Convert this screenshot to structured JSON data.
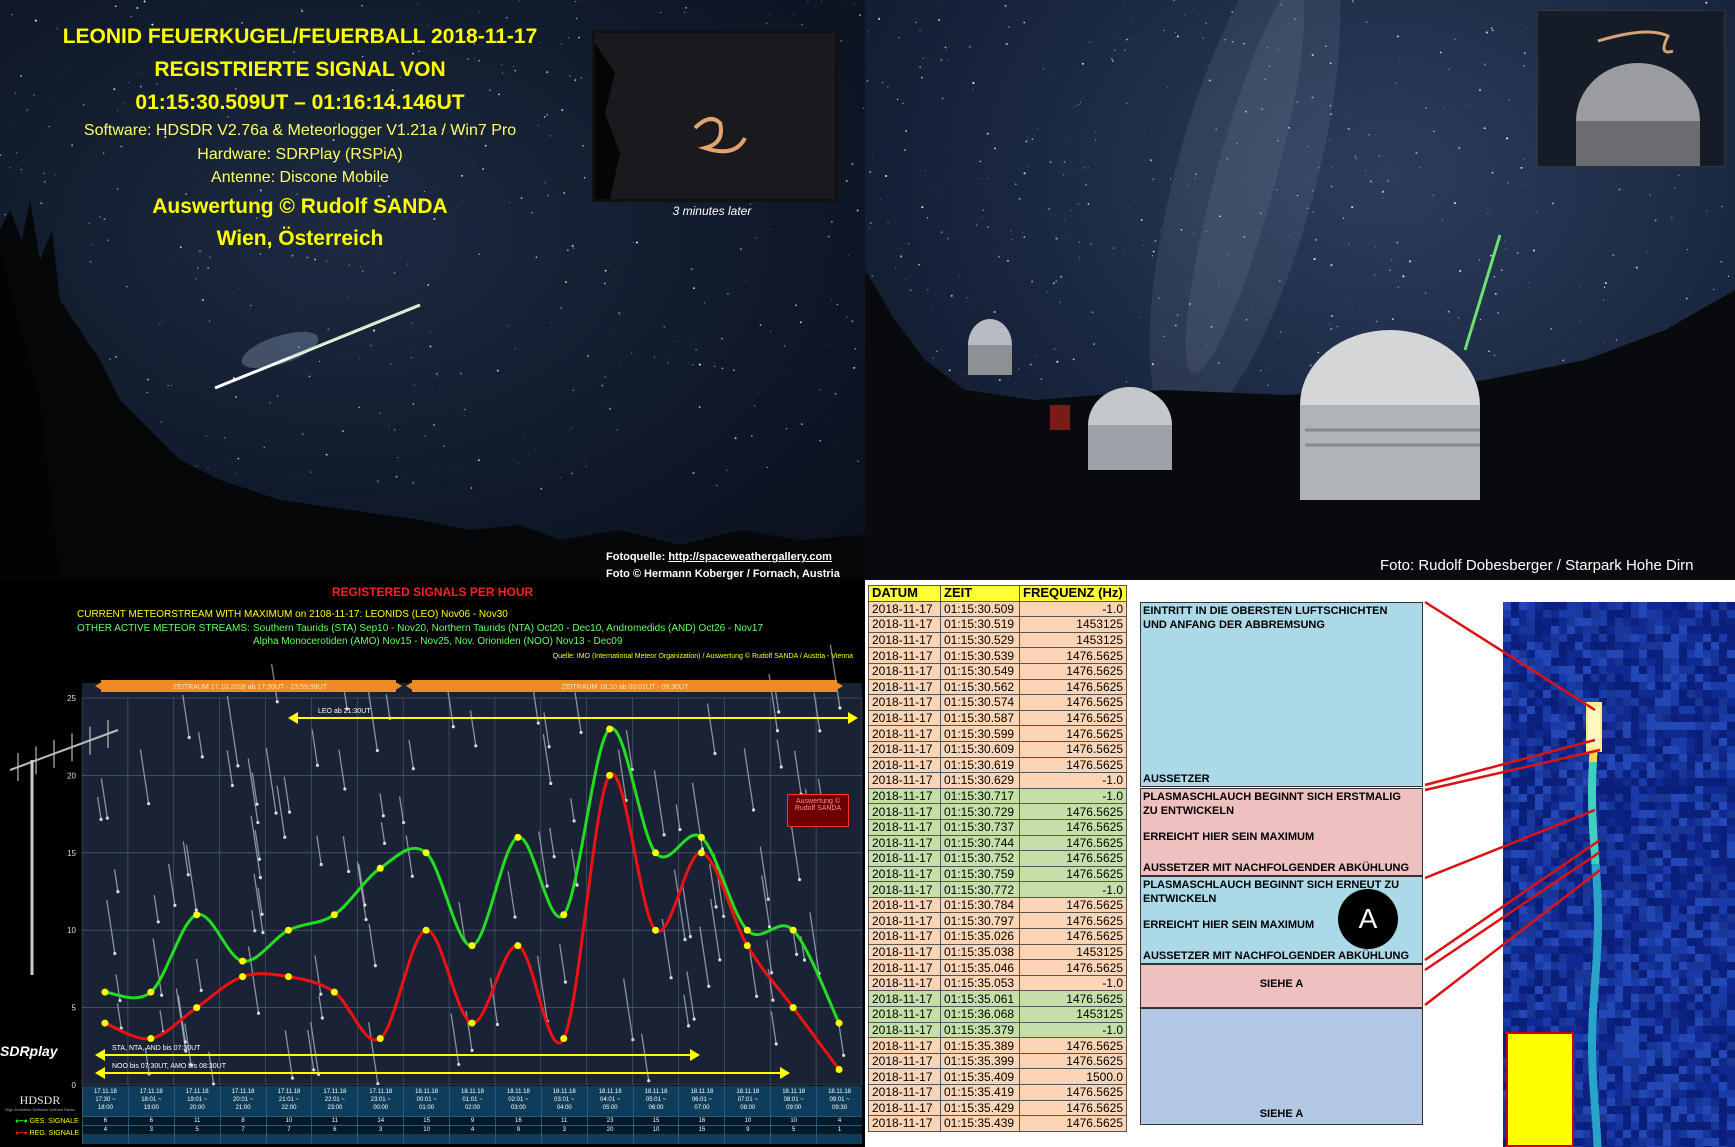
{
  "fireball": {
    "title_line1": "LEONID FEUERKUGEL/FEUERBALL 2018-11-17",
    "title_line2": "REGISTRIERTE SIGNAL VON",
    "title_line3": "01:15:30.509UT – 01:16:14.146UT",
    "software": "Software: HDSDR V2.76a & Meteorlogger V1.21a / Win7 Pro",
    "hardware": "Hardware: SDRPlay (RSPiA)",
    "antenna": "Antenne: Discone Mobile",
    "author": "Auswertung © Rudolf SANDA",
    "location": "Wien, Österreich",
    "inset_caption": "3 minutes later",
    "source_label": "Fotoquelle: ",
    "source_url": "http://spaceweathergallery.com",
    "photo_credit": "Foto © Hermann Koberger / Fornach, Austria"
  },
  "observatory": {
    "credit": "Foto: Rudolf Dobesberger /  Starpark Hohe Dirn"
  },
  "chart": {
    "title": "REGISTERED SIGNALS PER HOUR",
    "current_stream": "CURRENT METEORSTREAM WITH MAXIMUM on  2108-11-17: LEONIDS (LEO) Nov06 - Nov30",
    "other_label": "OTHER ACTIVE METEOR STREAMS:",
    "other_1": "Southern Taurids (STA)  Sep10 - Nov20, Northern Taurids (NTA)  Oct20 - Dec10, Andromedids (AND)  Oct26 - Nov17",
    "other_2": "Alpha Monocerotiden (AMO) Nov15 - Nov25, Nov. Orioniden (NOO) Nov13 - Dec09",
    "source": "Quelle: IMO (International Meteor Organization) / Auswertung © Rudolf SANDA / Austria - Vienna",
    "period_1": "ZEITRAUM 17.10.2018  ab 17:30UT - 23:59:59UT",
    "period_2": "ZEITRAUM 18.10 ab 00:01UT - 09:30UT",
    "leo_label": "LEO ab 21:30UT",
    "sta_label": "STA, NTA, AND bis 07:30UT",
    "noo_label": "NOO  bis 07:30UT,  AMO bis 08:30UT",
    "author_box_1": "Auswertung ©",
    "author_box_2": "Rudolf SANDA",
    "logo_sdr": "SDRplay",
    "logo_hdsdr": "HDSDR",
    "logo_hdsdr_sub": "High Definition Software Defined Radio",
    "legend_ges": "GES. SIGNALE",
    "legend_reg": "REG. SIGNALE"
  },
  "chart_data": {
    "type": "line",
    "title": "REGISTERED SIGNALS PER HOUR",
    "ylim": [
      0,
      25
    ],
    "yticks": [
      0,
      5,
      10,
      15,
      20,
      25
    ],
    "categories": [
      "17.11.18 17:30 ~ 18:00",
      "17.11.18 18:01 ~ 19:00",
      "17.11.18 19:01 ~ 20:00",
      "17.11.18 20:01 ~ 21:00",
      "17.11.18 21:01 ~ 22:00",
      "17.11.18 22:01 ~ 23:00",
      "17.11.18 23:01 ~ 00:00",
      "18.11.18 00:01 ~ 01:00",
      "18.11.18 01:01 ~ 02:00",
      "18.11.18 02:01 ~ 03:00",
      "18.11.18 03:01 ~ 04:00",
      "18.11.18 04:01 ~ 05:00",
      "18.11.18 05:01 ~ 06:00",
      "18.11.18 06:01 ~ 07:00",
      "18.11.18 07:01 ~ 08:00",
      "18.11.18 08:01 ~ 09:00",
      "18.11.18 09:01 ~ 09:30"
    ],
    "cat_date": [
      "17.11.18",
      "17.11.18",
      "17.11.18",
      "17.11.18",
      "17.11.18",
      "17.11.18",
      "17.11.18",
      "18.11.18",
      "18.11.18",
      "18.11.18",
      "18.11.18",
      "18.11.18",
      "18.11.18",
      "18.11.18",
      "18.11.18",
      "18.11.18",
      "18.11.18"
    ],
    "cat_time1": [
      "17:30 ~",
      "18:01 ~",
      "19:01 ~",
      "20:01 ~",
      "21:01 ~",
      "22:01 ~",
      "23:01 ~",
      "00:01 ~",
      "01:01 ~",
      "02:01 ~",
      "03:01 ~",
      "04:01 ~",
      "05:01 ~",
      "06:01 ~",
      "07:01 ~",
      "08:01 ~",
      "09:01 ~"
    ],
    "cat_time2": [
      "18:00",
      "19:00",
      "20:00",
      "21:00",
      "22:00",
      "23:00",
      "00:00",
      "01:00",
      "02:00",
      "03:00",
      "04:00",
      "05:00",
      "06:00",
      "07:00",
      "08:00",
      "09:00",
      "09:30"
    ],
    "series": [
      {
        "name": "GES. SIGNALE",
        "color": "#22dd22",
        "values": [
          6,
          6,
          11,
          8,
          10,
          11,
          14,
          15,
          9,
          16,
          11,
          23,
          15,
          16,
          10,
          10,
          4
        ]
      },
      {
        "name": "REG. SIGNALE",
        "color": "#ee1111",
        "values": [
          4,
          3,
          5,
          7,
          7,
          6,
          3,
          10,
          4,
          9,
          3,
          20,
          10,
          15,
          9,
          5,
          1
        ]
      }
    ]
  },
  "log": {
    "headers": [
      "DATUM",
      "ZEIT",
      "FREQUENZ (Hz)"
    ],
    "rows": [
      [
        "2018-11-17",
        "01:15:30.509",
        "-1.0"
      ],
      [
        "2018-11-17",
        "01:15:30.519",
        "1453125"
      ],
      [
        "2018-11-17",
        "01:15:30.529",
        "1453125"
      ],
      [
        "2018-11-17",
        "01:15:30.539",
        "1476.5625"
      ],
      [
        "2018-11-17",
        "01:15:30.549",
        "1476.5625"
      ],
      [
        "2018-11-17",
        "01:15:30.562",
        "1476.5625"
      ],
      [
        "2018-11-17",
        "01:15:30.574",
        "1476.5625"
      ],
      [
        "2018-11-17",
        "01:15:30.587",
        "1476.5625"
      ],
      [
        "2018-11-17",
        "01:15:30.599",
        "1476.5625"
      ],
      [
        "2018-11-17",
        "01:15:30.609",
        "1476.5625"
      ],
      [
        "2018-11-17",
        "01:15:30.619",
        "1476.5625"
      ],
      [
        "2018-11-17",
        "01:15:30.629",
        "-1.0"
      ],
      [
        "2018-11-17",
        "01:15:30.717",
        "-1.0"
      ],
      [
        "2018-11-17",
        "01:15:30.729",
        "1476.5625"
      ],
      [
        "2018-11-17",
        "01:15:30.737",
        "1476.5625"
      ],
      [
        "2018-11-17",
        "01:15:30.744",
        "1476.5625"
      ],
      [
        "2018-11-17",
        "01:15:30.752",
        "1476.5625"
      ],
      [
        "2018-11-17",
        "01:15:30.759",
        "1476.5625"
      ],
      [
        "2018-11-17",
        "01:15:30.772",
        "-1.0"
      ],
      [
        "2018-11-17",
        "01:15:30.784",
        "1476.5625"
      ],
      [
        "2018-11-17",
        "01:15:30.797",
        "1476.5625"
      ],
      [
        "2018-11-17",
        "01:15:35.026",
        "1476.5625"
      ],
      [
        "2018-11-17",
        "01:15:35.038",
        "1453125"
      ],
      [
        "2018-11-17",
        "01:15:35.046",
        "1476.5625"
      ],
      [
        "2018-11-17",
        "01:15:35.053",
        "-1.0"
      ],
      [
        "2018-11-17",
        "01:15:35.061",
        "1476.5625"
      ],
      [
        "2018-11-17",
        "01:15:36.068",
        "1453125"
      ],
      [
        "2018-11-17",
        "01:15:35.379",
        "-1.0"
      ],
      [
        "2018-11-17",
        "01:15:35.389",
        "1476.5625"
      ],
      [
        "2018-11-17",
        "01:15:35.399",
        "1476.5625"
      ],
      [
        "2018-11-17",
        "01:15:35.409",
        "1500.0"
      ],
      [
        "2018-11-17",
        "01:15:35.419",
        "1476.5625"
      ],
      [
        "2018-11-17",
        "01:15:35.429",
        "1476.5625"
      ],
      [
        "2018-11-17",
        "01:15:35.439",
        "1476.5625"
      ]
    ],
    "notes": {
      "n1": "EINTRITT IN DIE OBERSTEN LUFTSCHICHTEN",
      "n2": "UND ANFANG DER ABBREMSUNG",
      "n3": "AUSSETZER",
      "n4": "PLASMASCHLAUCH BEGINNT SICH ERSTMALIG",
      "n5": "ZU ENTWICKELN",
      "n6": "ERREICHT HIER SEIN MAXIMUM",
      "n7": "AUSSETZER MIT NACHFOLGENDER ABKÜHLUNG",
      "n8": "PLASMASCHLAUCH BEGINNT SICH ERNEUT ZU",
      "n9": "ENTWICKELN",
      "n10": "ERREICHT HIER SEIN MAXIMUM",
      "n11": "AUSSETZER MIT NACHFOLGENDER ABKÜHLUNG",
      "n12": "SIEHE A",
      "n13": "SIEHE A",
      "marker": "A"
    }
  }
}
